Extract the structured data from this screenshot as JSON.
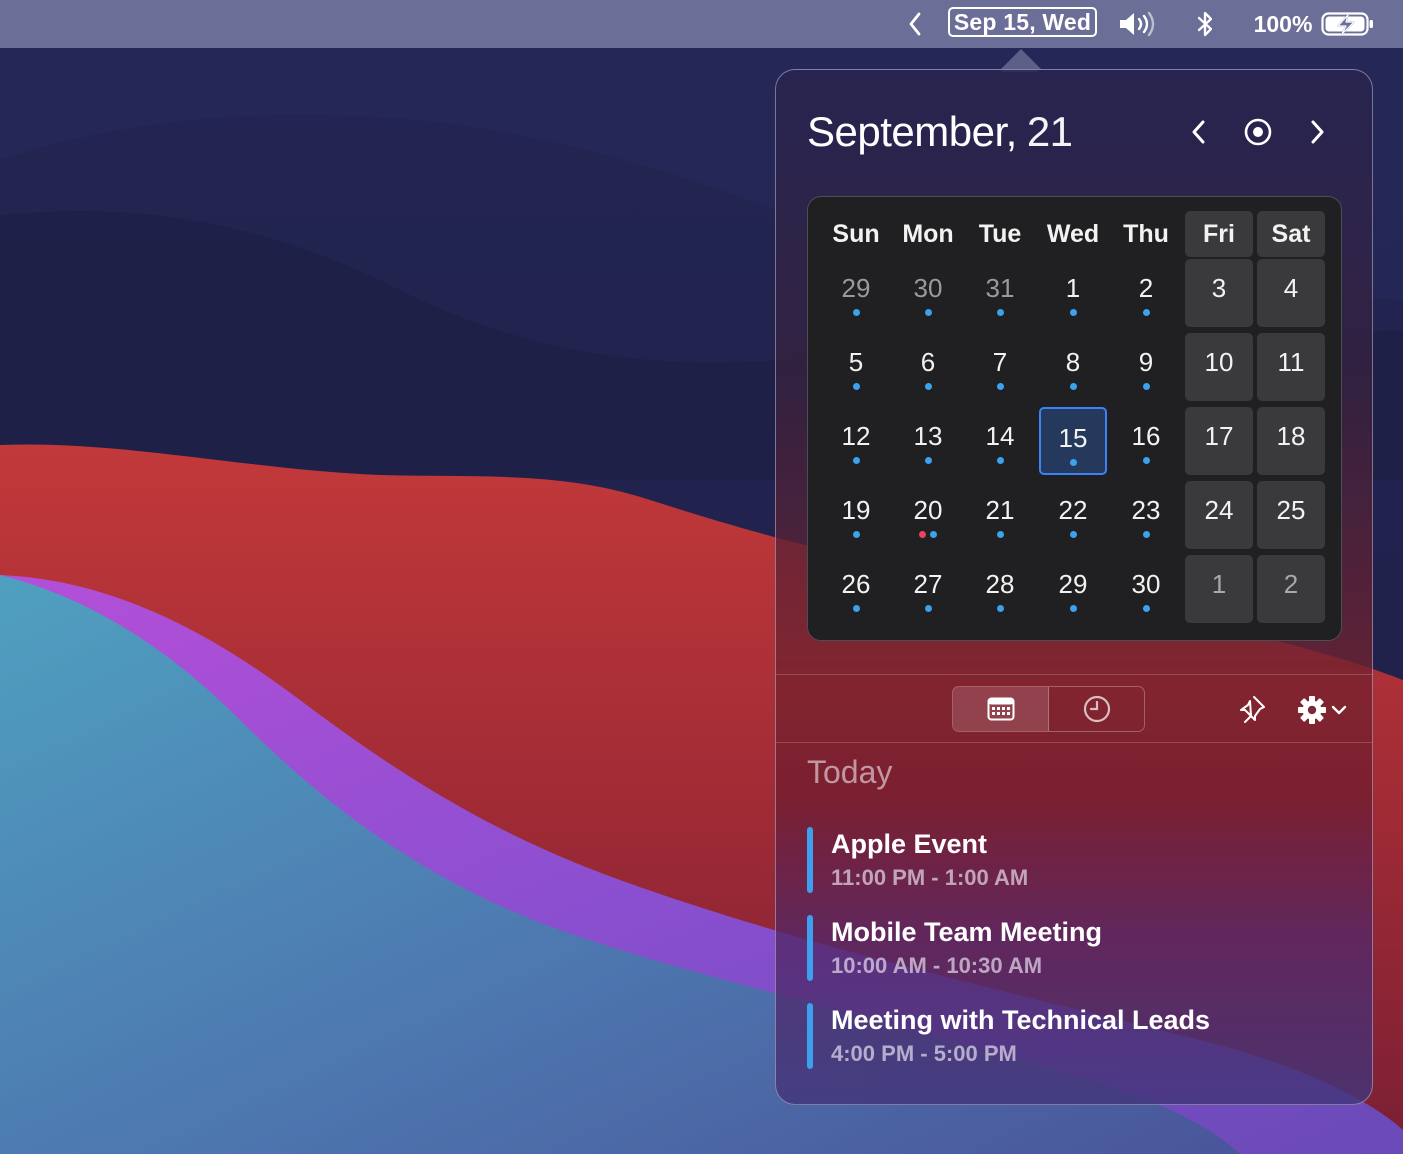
{
  "menubar": {
    "date_label": "Sep 15, Wed",
    "battery_percent": "100%",
    "battery_level": 1.0,
    "battery_charging": true
  },
  "calendar": {
    "month": "September,",
    "year": "21",
    "weekdays": [
      "Sun",
      "Mon",
      "Tue",
      "Wed",
      "Thu",
      "Fri",
      "Sat"
    ],
    "weeks": [
      [
        {
          "day": "29",
          "other": true,
          "dots": [
            "blue"
          ]
        },
        {
          "day": "30",
          "other": true,
          "dots": [
            "blue"
          ]
        },
        {
          "day": "31",
          "other": true,
          "dots": [
            "blue"
          ]
        },
        {
          "day": "1",
          "dots": [
            "blue"
          ]
        },
        {
          "day": "2",
          "dots": [
            "blue"
          ]
        },
        {
          "day": "3",
          "dots": []
        },
        {
          "day": "4",
          "dots": []
        }
      ],
      [
        {
          "day": "5",
          "dots": [
            "blue"
          ]
        },
        {
          "day": "6",
          "dots": [
            "blue"
          ]
        },
        {
          "day": "7",
          "dots": [
            "blue"
          ]
        },
        {
          "day": "8",
          "dots": [
            "blue"
          ]
        },
        {
          "day": "9",
          "dots": [
            "blue"
          ]
        },
        {
          "day": "10",
          "dots": []
        },
        {
          "day": "11",
          "dots": []
        }
      ],
      [
        {
          "day": "12",
          "dots": [
            "blue"
          ]
        },
        {
          "day": "13",
          "dots": [
            "blue"
          ]
        },
        {
          "day": "14",
          "dots": [
            "blue"
          ]
        },
        {
          "day": "15",
          "today": true,
          "dots": [
            "blue"
          ]
        },
        {
          "day": "16",
          "dots": [
            "blue"
          ]
        },
        {
          "day": "17",
          "dots": []
        },
        {
          "day": "18",
          "dots": []
        }
      ],
      [
        {
          "day": "19",
          "dots": [
            "blue"
          ]
        },
        {
          "day": "20",
          "dots": [
            "red",
            "blue"
          ]
        },
        {
          "day": "21",
          "dots": [
            "blue"
          ]
        },
        {
          "day": "22",
          "dots": [
            "blue"
          ]
        },
        {
          "day": "23",
          "dots": [
            "blue"
          ]
        },
        {
          "day": "24",
          "dots": []
        },
        {
          "day": "25",
          "dots": []
        }
      ],
      [
        {
          "day": "26",
          "dots": [
            "blue"
          ]
        },
        {
          "day": "27",
          "dots": [
            "blue"
          ]
        },
        {
          "day": "28",
          "dots": [
            "blue"
          ]
        },
        {
          "day": "29",
          "dots": [
            "blue"
          ]
        },
        {
          "day": "30",
          "dots": [
            "blue"
          ]
        },
        {
          "day": "1",
          "other": true,
          "dots": []
        },
        {
          "day": "2",
          "other": true,
          "dots": []
        }
      ]
    ]
  },
  "toolbar": {
    "view_buttons": [
      {
        "icon": "calendar-icon",
        "active": true
      },
      {
        "icon": "clock-icon",
        "active": false
      }
    ],
    "pin_icon": "pin-icon",
    "settings_icon": "gear-icon"
  },
  "events": {
    "section_label": "Today",
    "items": [
      {
        "title": "Apple Event",
        "time": "11:00 PM - 1:00 AM",
        "color": "#3ca0ee"
      },
      {
        "title": "Mobile Team Meeting",
        "time": "10:00 AM - 10:30 AM",
        "color": "#3ca0ee"
      },
      {
        "title": "Meeting with Technical Leads",
        "time": "4:00 PM - 5:00 PM",
        "color": "#3ca0ee"
      }
    ]
  },
  "colors": {
    "accent": "#3ba3ee",
    "event_dot_red": "#e84361",
    "today_border": "#3b82f6"
  }
}
